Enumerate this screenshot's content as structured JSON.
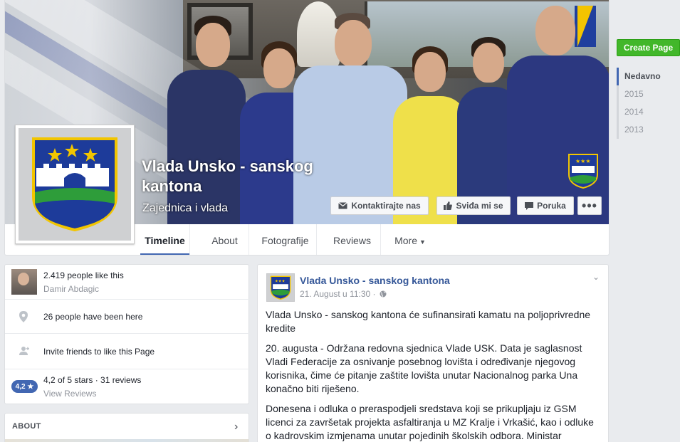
{
  "page": {
    "name": "Vlada Unsko - sanskog kantona",
    "category": "Zajednica i vlada"
  },
  "cover_actions": {
    "contact": "Kontaktirajte nas",
    "like": "Sviđa mi se",
    "message": "Poruka",
    "more": "•••"
  },
  "tabs": [
    {
      "label": "Timeline"
    },
    {
      "label": "About"
    },
    {
      "label": "Fotografije"
    },
    {
      "label": "Reviews"
    },
    {
      "label": "More"
    }
  ],
  "right_nav": {
    "create_page": "Create Page",
    "years": [
      "Nedavno",
      "2015",
      "2014",
      "2013"
    ]
  },
  "left": {
    "likes": "2.419 people like this",
    "likes_friend": "Damir Abdagic",
    "been_here": "26 people have been here",
    "invite": "Invite friends to like this Page",
    "rating_pill": "4,2 ★",
    "rating_text": "4,2 of 5 stars · 31 reviews",
    "view_reviews": "View Reviews",
    "about_title": "ABOUT"
  },
  "post": {
    "author": "Vlada Unsko - sanskog kantona",
    "time": "21. August u 11:30 ·",
    "paragraphs": [
      "Vlada Unsko - sanskog kantona će sufinansirati kamatu na poljoprivredne kredite",
      "20. augusta - Održana redovna sjednica Vlade USK. Data je saglasnost Vladi Federacije za osnivanje posebnog lovišta i određivanje njegovog korisnika, čime će pitanje zaštite lovišta unutar Nacionalnog parka Una konačno biti riješeno.",
      "Donesena i odluka o preraspodjeli sredstava koji se prikupljaju iz GSM licenci za završetak projekta asfaltiranja u MZ Kralje i Vrkašić, kao i odluke o kadrovskim izmjenama unutar pojedinih školskih odbora. Ministar"
    ]
  },
  "colors": {
    "link": "#365899",
    "accent": "#4267b2",
    "create_green": "#42b72a",
    "crest_blue": "#1d3b9a",
    "crest_green": "#2e9d3a",
    "crest_gold": "#f2c500"
  }
}
